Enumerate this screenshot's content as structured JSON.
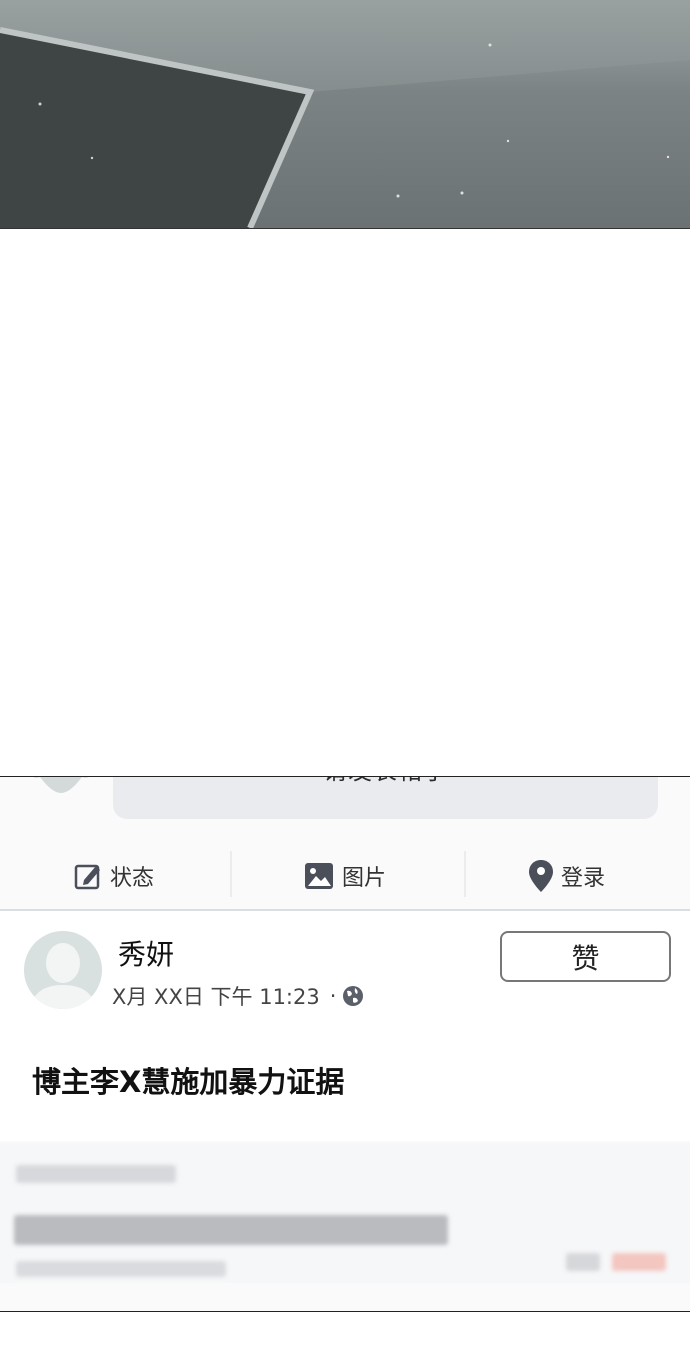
{
  "composer": {
    "placeholder": "请发表帖子"
  },
  "actions": [
    {
      "label": "状态",
      "icon": "edit-icon"
    },
    {
      "label": "图片",
      "icon": "image-icon"
    },
    {
      "label": "登录",
      "icon": "location-pin-icon"
    }
  ],
  "post": {
    "author": "秀妍",
    "date": "X月 XX日",
    "time": "下午 11:23",
    "separator": "·",
    "privacy_icon": "globe-icon",
    "like_label": "赞",
    "content": "博主李X慧施加暴力证据"
  },
  "colors": {
    "composer_bg": "#e9ebee",
    "panel_bg": "#fafafb",
    "divider": "#dadde1",
    "avatar_bg": "#d8e0e0"
  }
}
